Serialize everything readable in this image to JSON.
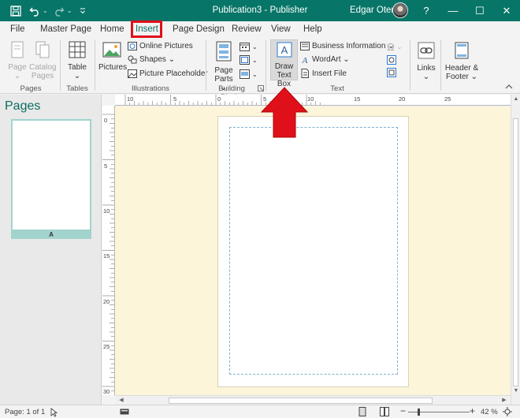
{
  "app": {
    "title": "Publication3  -  Publisher",
    "user_name": "Edgar Otero"
  },
  "quick_access": [
    "save-icon",
    "undo-icon",
    "redo-icon",
    "customize-icon"
  ],
  "window_controls": {
    "help": "?",
    "minimize": "—",
    "maximize": "☐",
    "close": "✕"
  },
  "menu": {
    "tabs": [
      "File",
      "Master Page",
      "Home",
      "Insert",
      "Page Design",
      "Review",
      "View",
      "Help"
    ],
    "active": "Insert"
  },
  "ribbon": {
    "groups": {
      "pages": "Pages",
      "tables": "Tables",
      "illustrations": "Illustrations",
      "building_blocks": "Building Blocks",
      "text": "Text"
    },
    "page_btn": [
      "Page",
      "⌄"
    ],
    "catalog_btn": [
      "Catalog",
      "Pages"
    ],
    "table_btn": [
      "Table",
      "⌄"
    ],
    "pictures_btn": "Pictures",
    "online_pictures": "Online Pictures",
    "shapes": "Shapes ⌄",
    "picture_placeholder": "Picture Placeholder",
    "page_parts": [
      "Page",
      "Parts ⌄"
    ],
    "draw_text_box": [
      "Draw",
      "Text Box"
    ],
    "business_information": "Business Information ⌄",
    "wordart": "WordArt ⌄",
    "insert_file": "Insert File",
    "links": [
      "Links",
      "⌄"
    ],
    "header_footer": [
      "Header &",
      "Footer ⌄"
    ]
  },
  "pages_panel": {
    "title": "Pages",
    "thumb_label": "A"
  },
  "rulers": {
    "h_labels": [
      "10",
      "5",
      "0",
      "5",
      "10",
      "15",
      "20",
      "25"
    ],
    "v_labels": [
      "0",
      "5",
      "10",
      "15",
      "20",
      "25",
      "30"
    ]
  },
  "status": {
    "page": "Page: 1 of 1",
    "zoom": "42 %"
  },
  "colors": {
    "brand": "#077568",
    "highlight_box": "#e0101b",
    "arrow": "#e0101b"
  }
}
